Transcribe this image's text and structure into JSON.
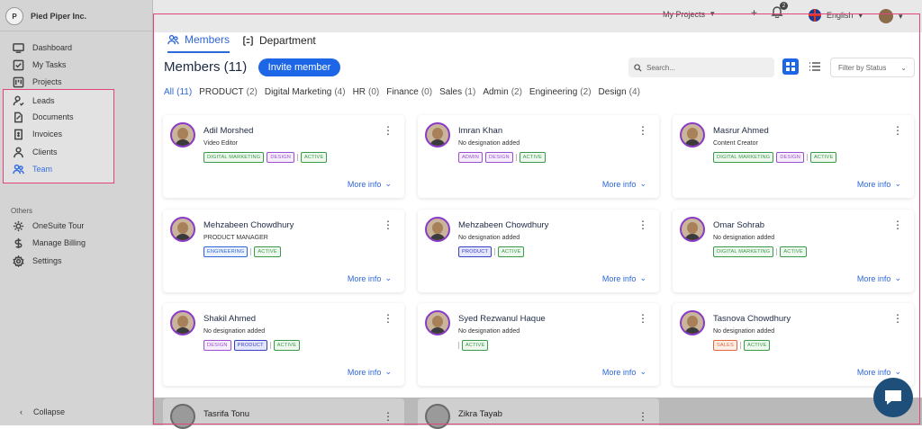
{
  "brand": {
    "name": "Pied Piper Inc.",
    "logo_text": "P"
  },
  "sidebar": {
    "items": [
      {
        "label": "Dashboard",
        "icon": "dashboard-icon"
      },
      {
        "label": "My Tasks",
        "icon": "tasks-icon"
      },
      {
        "label": "Projects",
        "icon": "projects-icon"
      },
      {
        "label": "Leads",
        "icon": "leads-icon"
      },
      {
        "label": "Documents",
        "icon": "documents-icon"
      },
      {
        "label": "Invoices",
        "icon": "invoices-icon"
      },
      {
        "label": "Clients",
        "icon": "clients-icon"
      },
      {
        "label": "Team",
        "icon": "team-icon",
        "active": true
      }
    ],
    "others_label": "Others",
    "others": [
      {
        "label": "OneSuite Tour",
        "icon": "tour-icon"
      },
      {
        "label": "Manage Billing",
        "icon": "billing-icon"
      },
      {
        "label": "Settings",
        "icon": "settings-icon"
      }
    ],
    "collapse_label": "Collapse"
  },
  "topbar": {
    "projects_label": "My Projects",
    "notification_count": "2",
    "language": "English"
  },
  "tabs": [
    {
      "label": "Members",
      "active": true
    },
    {
      "label": "Department",
      "active": false
    }
  ],
  "header": {
    "title": "Members (11)",
    "invite_label": "Invite member",
    "search_placeholder": "Search...",
    "filter_label": "Filter by Status"
  },
  "filters": [
    {
      "label": "All",
      "count": "(11)",
      "active": true
    },
    {
      "label": "PRODUCT",
      "count": "(2)"
    },
    {
      "label": "Digital Marketing",
      "count": "(4)"
    },
    {
      "label": "HR",
      "count": "(0)"
    },
    {
      "label": "Finance",
      "count": "(0)"
    },
    {
      "label": "Sales",
      "count": "(1)"
    },
    {
      "label": "Admin",
      "count": "(2)"
    },
    {
      "label": "Engineering",
      "count": "(2)"
    },
    {
      "label": "Design",
      "count": "(4)"
    }
  ],
  "more_info_label": "More info",
  "members": [
    {
      "name": "Adil Morshed",
      "role": "Video Editor",
      "badges": [
        {
          "t": "DIGITAL MARKETING",
          "c": "green"
        },
        {
          "t": "DESIGN",
          "c": "purple"
        },
        {
          "t": "ACTIVE",
          "c": "green",
          "sep": true
        }
      ]
    },
    {
      "name": "Imran Khan",
      "role": "No designation added",
      "badges": [
        {
          "t": "ADMIN",
          "c": "purple"
        },
        {
          "t": "DESIGN",
          "c": "purple"
        },
        {
          "t": "ACTIVE",
          "c": "green",
          "sep": true
        }
      ]
    },
    {
      "name": "Masrur Ahmed",
      "role": "Content Creator",
      "badges": [
        {
          "t": "DIGITAL MARKETING",
          "c": "green"
        },
        {
          "t": "DESIGN",
          "c": "purple"
        },
        {
          "t": "ACTIVE",
          "c": "green",
          "sep": true
        }
      ]
    },
    {
      "name": "Mehzabeen Chowdhury",
      "role": "PRODUCT MANAGER",
      "badges": [
        {
          "t": "ENGINEERING",
          "c": "blue"
        },
        {
          "t": "ACTIVE",
          "c": "green",
          "sep": true
        }
      ]
    },
    {
      "name": "Mehzabeen Chowdhury",
      "role": "No designation added",
      "badges": [
        {
          "t": "PRODUCT",
          "c": "indigo"
        },
        {
          "t": "ACTIVE",
          "c": "green",
          "sep": true
        }
      ]
    },
    {
      "name": "Omar Sohrab",
      "role": "No designation added",
      "badges": [
        {
          "t": "DIGITAL MARKETING",
          "c": "green"
        },
        {
          "t": "ACTIVE",
          "c": "green",
          "sep": true
        }
      ]
    },
    {
      "name": "Shakil Ahmed",
      "role": "No designation added",
      "badges": [
        {
          "t": "DESIGN",
          "c": "purple"
        },
        {
          "t": "PRODUCT",
          "c": "indigo"
        },
        {
          "t": "ACTIVE",
          "c": "green",
          "sep": true
        }
      ]
    },
    {
      "name": "Syed Rezwanul Haque",
      "role": "No designation added",
      "badges": [
        {
          "t": "ACTIVE",
          "c": "green",
          "sep": true
        }
      ]
    },
    {
      "name": "Tasnova Chowdhury",
      "role": "No designation added",
      "badges": [
        {
          "t": "SALES",
          "c": "orange"
        },
        {
          "t": "ACTIVE",
          "c": "green",
          "sep": true
        }
      ]
    }
  ],
  "partial_members": [
    {
      "name": "Tasrifa Tonu"
    },
    {
      "name": "Zikra Tayab"
    }
  ],
  "colors": {
    "accent": "#1d67e6",
    "highlight_border": "#e0447a",
    "green": "#3a9a4a",
    "purple": "#9b4fd1",
    "blue": "#2e67d8",
    "indigo": "#3b3fc4",
    "orange": "#e2673a"
  }
}
